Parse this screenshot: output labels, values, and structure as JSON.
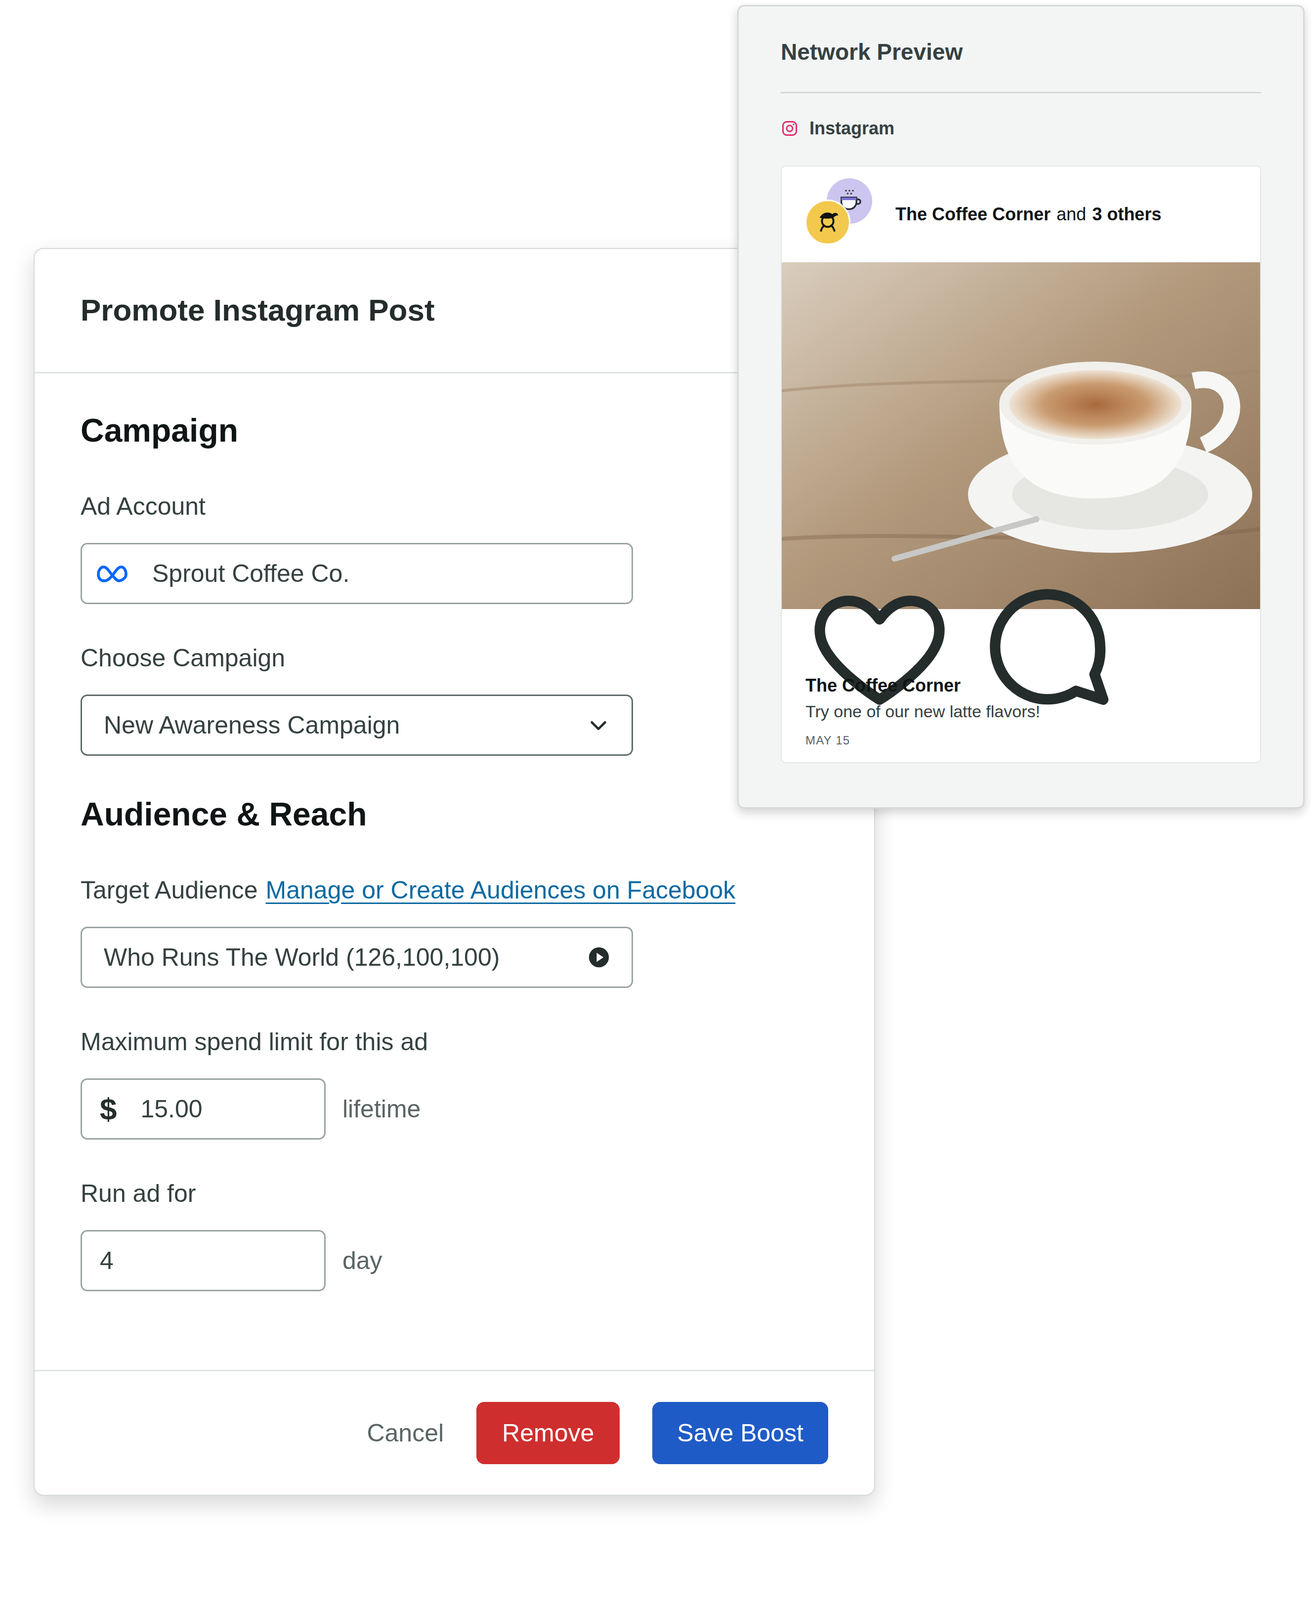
{
  "modal": {
    "title": "Promote Instagram Post"
  },
  "campaign": {
    "heading": "Campaign",
    "ad_account": {
      "label": "Ad Account",
      "value": "Sprout Coffee Co."
    },
    "choose_campaign": {
      "label": "Choose Campaign",
      "value": "New Awareness Campaign"
    }
  },
  "audience": {
    "heading": "Audience & Reach",
    "target": {
      "label": "Target Audience",
      "link": "Manage or Create Audiences on Facebook",
      "value": "Who Runs The World (126,100,100)"
    },
    "spend": {
      "label": "Maximum spend limit for this ad",
      "currency": "$",
      "value": "15.00",
      "unit": "lifetime"
    },
    "duration": {
      "label": "Run ad for",
      "value": "4",
      "unit": "day"
    }
  },
  "buttons": [
    {
      "label": "Cancel",
      "kind": "link"
    },
    {
      "label": "Remove",
      "kind": "danger"
    },
    {
      "label": "Save Boost",
      "kind": "primary"
    }
  ],
  "preview": {
    "title": "Network Preview",
    "network": "Instagram",
    "post": {
      "author": "The Coffee Corner",
      "connector": "and",
      "others": "3 others",
      "caption_author": "The Coffee Corner",
      "caption": "Try one of our new latte flavors!",
      "date": "MAY 15"
    }
  }
}
